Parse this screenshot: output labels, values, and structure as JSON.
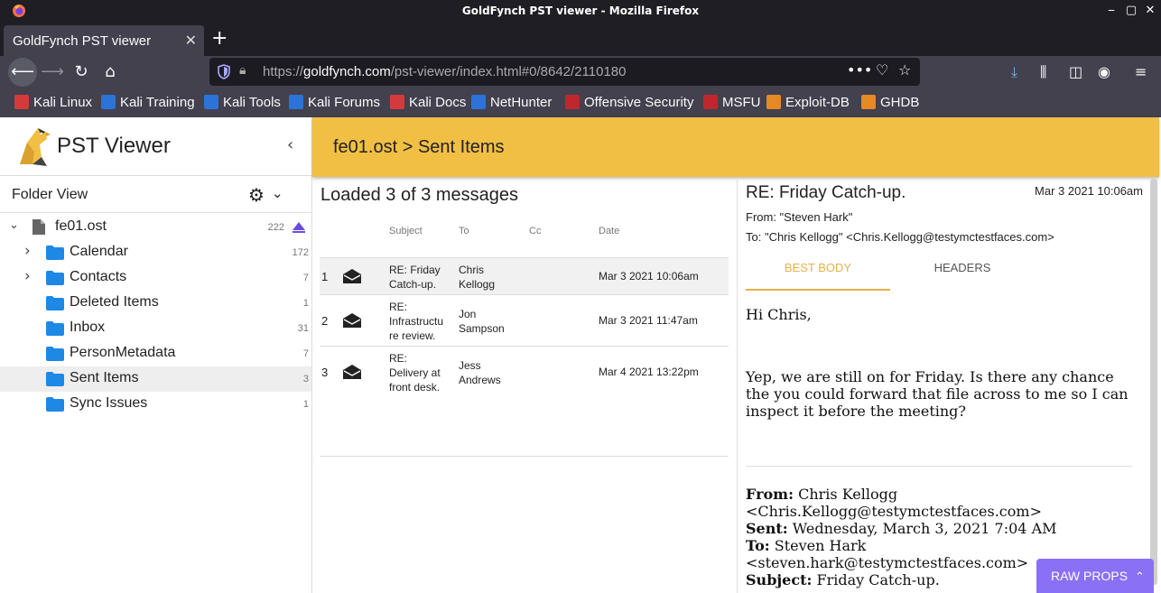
{
  "window": {
    "title": "GoldFynch PST viewer - Mozilla Firefox",
    "controls": [
      "✕",
      "▢",
      "⎯"
    ]
  },
  "browser": {
    "tab_title": "GoldFynch PST viewer",
    "url_prefix": "https://",
    "url_domain": "goldfynch.com",
    "url_path": "/pst-viewer/index.html#0/8642/2110180",
    "bookmarks": [
      {
        "label": "Kali Linux",
        "icon_color": "#d53a3a"
      },
      {
        "label": "Kali Training",
        "icon_color": "#2b73d6"
      },
      {
        "label": "Kali Tools",
        "icon_color": "#2b73d6"
      },
      {
        "label": "Kali Forums",
        "icon_color": "#2b73d6"
      },
      {
        "label": "Kali Docs",
        "icon_color": "#d53a3a"
      },
      {
        "label": "NetHunter",
        "icon_color": "#2b73d6"
      },
      {
        "label": "Offensive Security",
        "icon_color": "#c0262d"
      },
      {
        "label": "MSFU",
        "icon_color": "#c0262d"
      },
      {
        "label": "Exploit-DB",
        "icon_color": "#e58a25"
      },
      {
        "label": "GHDB",
        "icon_color": "#e58a25"
      }
    ]
  },
  "app": {
    "title": "PST Viewer",
    "folder_view_label": "Folder View",
    "breadcrumb": "fe01.ost > Sent Items",
    "root": {
      "label": "fe01.ost",
      "count": "222"
    },
    "folders": [
      {
        "label": "Calendar",
        "count": "172",
        "expandable": true,
        "selected": false
      },
      {
        "label": "Contacts",
        "count": "7",
        "expandable": true,
        "selected": false
      },
      {
        "label": "Deleted Items",
        "count": "1",
        "expandable": false,
        "selected": false
      },
      {
        "label": "Inbox",
        "count": "31",
        "expandable": false,
        "selected": false
      },
      {
        "label": "PersonMetadata",
        "count": "7",
        "expandable": false,
        "selected": false
      },
      {
        "label": "Sent Items",
        "count": "3",
        "expandable": false,
        "selected": true
      },
      {
        "label": "Sync Issues",
        "count": "1",
        "expandable": false,
        "selected": false
      }
    ],
    "accent_color": "#f2bf45",
    "folder_color": "#1e88e5"
  },
  "message_list": {
    "status": "Loaded 3 of 3 messages",
    "columns": {
      "subject": "Subject",
      "to": "To",
      "cc": "Cc",
      "date": "Date"
    },
    "rows": [
      {
        "num": "1",
        "subject_lines": [
          "RE: Friday",
          "Catch-up."
        ],
        "to_lines": [
          "Chris",
          "Kellogg"
        ],
        "cc": "",
        "date": "Mar 3 2021 10:06am",
        "selected": true
      },
      {
        "num": "2",
        "subject_lines": [
          "RE:",
          "Infrastructu",
          "re review."
        ],
        "to_lines": [
          "Jon",
          "Sampson"
        ],
        "cc": "",
        "date": "Mar 3 2021 11:47am",
        "selected": false
      },
      {
        "num": "3",
        "subject_lines": [
          "RE:",
          "Delivery at",
          "front desk."
        ],
        "to_lines": [
          "Jess",
          "Andrews"
        ],
        "cc": "",
        "date": "Mar 4 2021 13:22pm",
        "selected": false
      }
    ]
  },
  "reader": {
    "subject": "RE: Friday Catch-up.",
    "date": "Mar 3 2021 10:06am",
    "from": "From: \"Steven Hark\"",
    "to": "To: \"Chris Kellogg\" <Chris.Kellogg@testymctestfaces.com>",
    "tab_best_body": "BEST BODY",
    "tab_headers": "HEADERS",
    "greeting": "Hi Chris,",
    "paragraph": "Yep, we are still on for Friday.   Is there any chance the you could forward that file across to me so I can inspect it before the meeting?",
    "quoted": {
      "from_label": "From:",
      "from_value": "Chris Kellogg <Chris.Kellogg@testymctestfaces.com>",
      "sent_label": "Sent:",
      "sent_value": "Wednesday, March 3, 2021 7:04 AM",
      "to_label": "To:",
      "to_value": "Steven Hark <steven.hark@testymctestfaces.com>",
      "subject_label": "Subject:",
      "subject_value": "Friday Catch-up."
    },
    "raw_props_label": "RAW PROPS"
  }
}
